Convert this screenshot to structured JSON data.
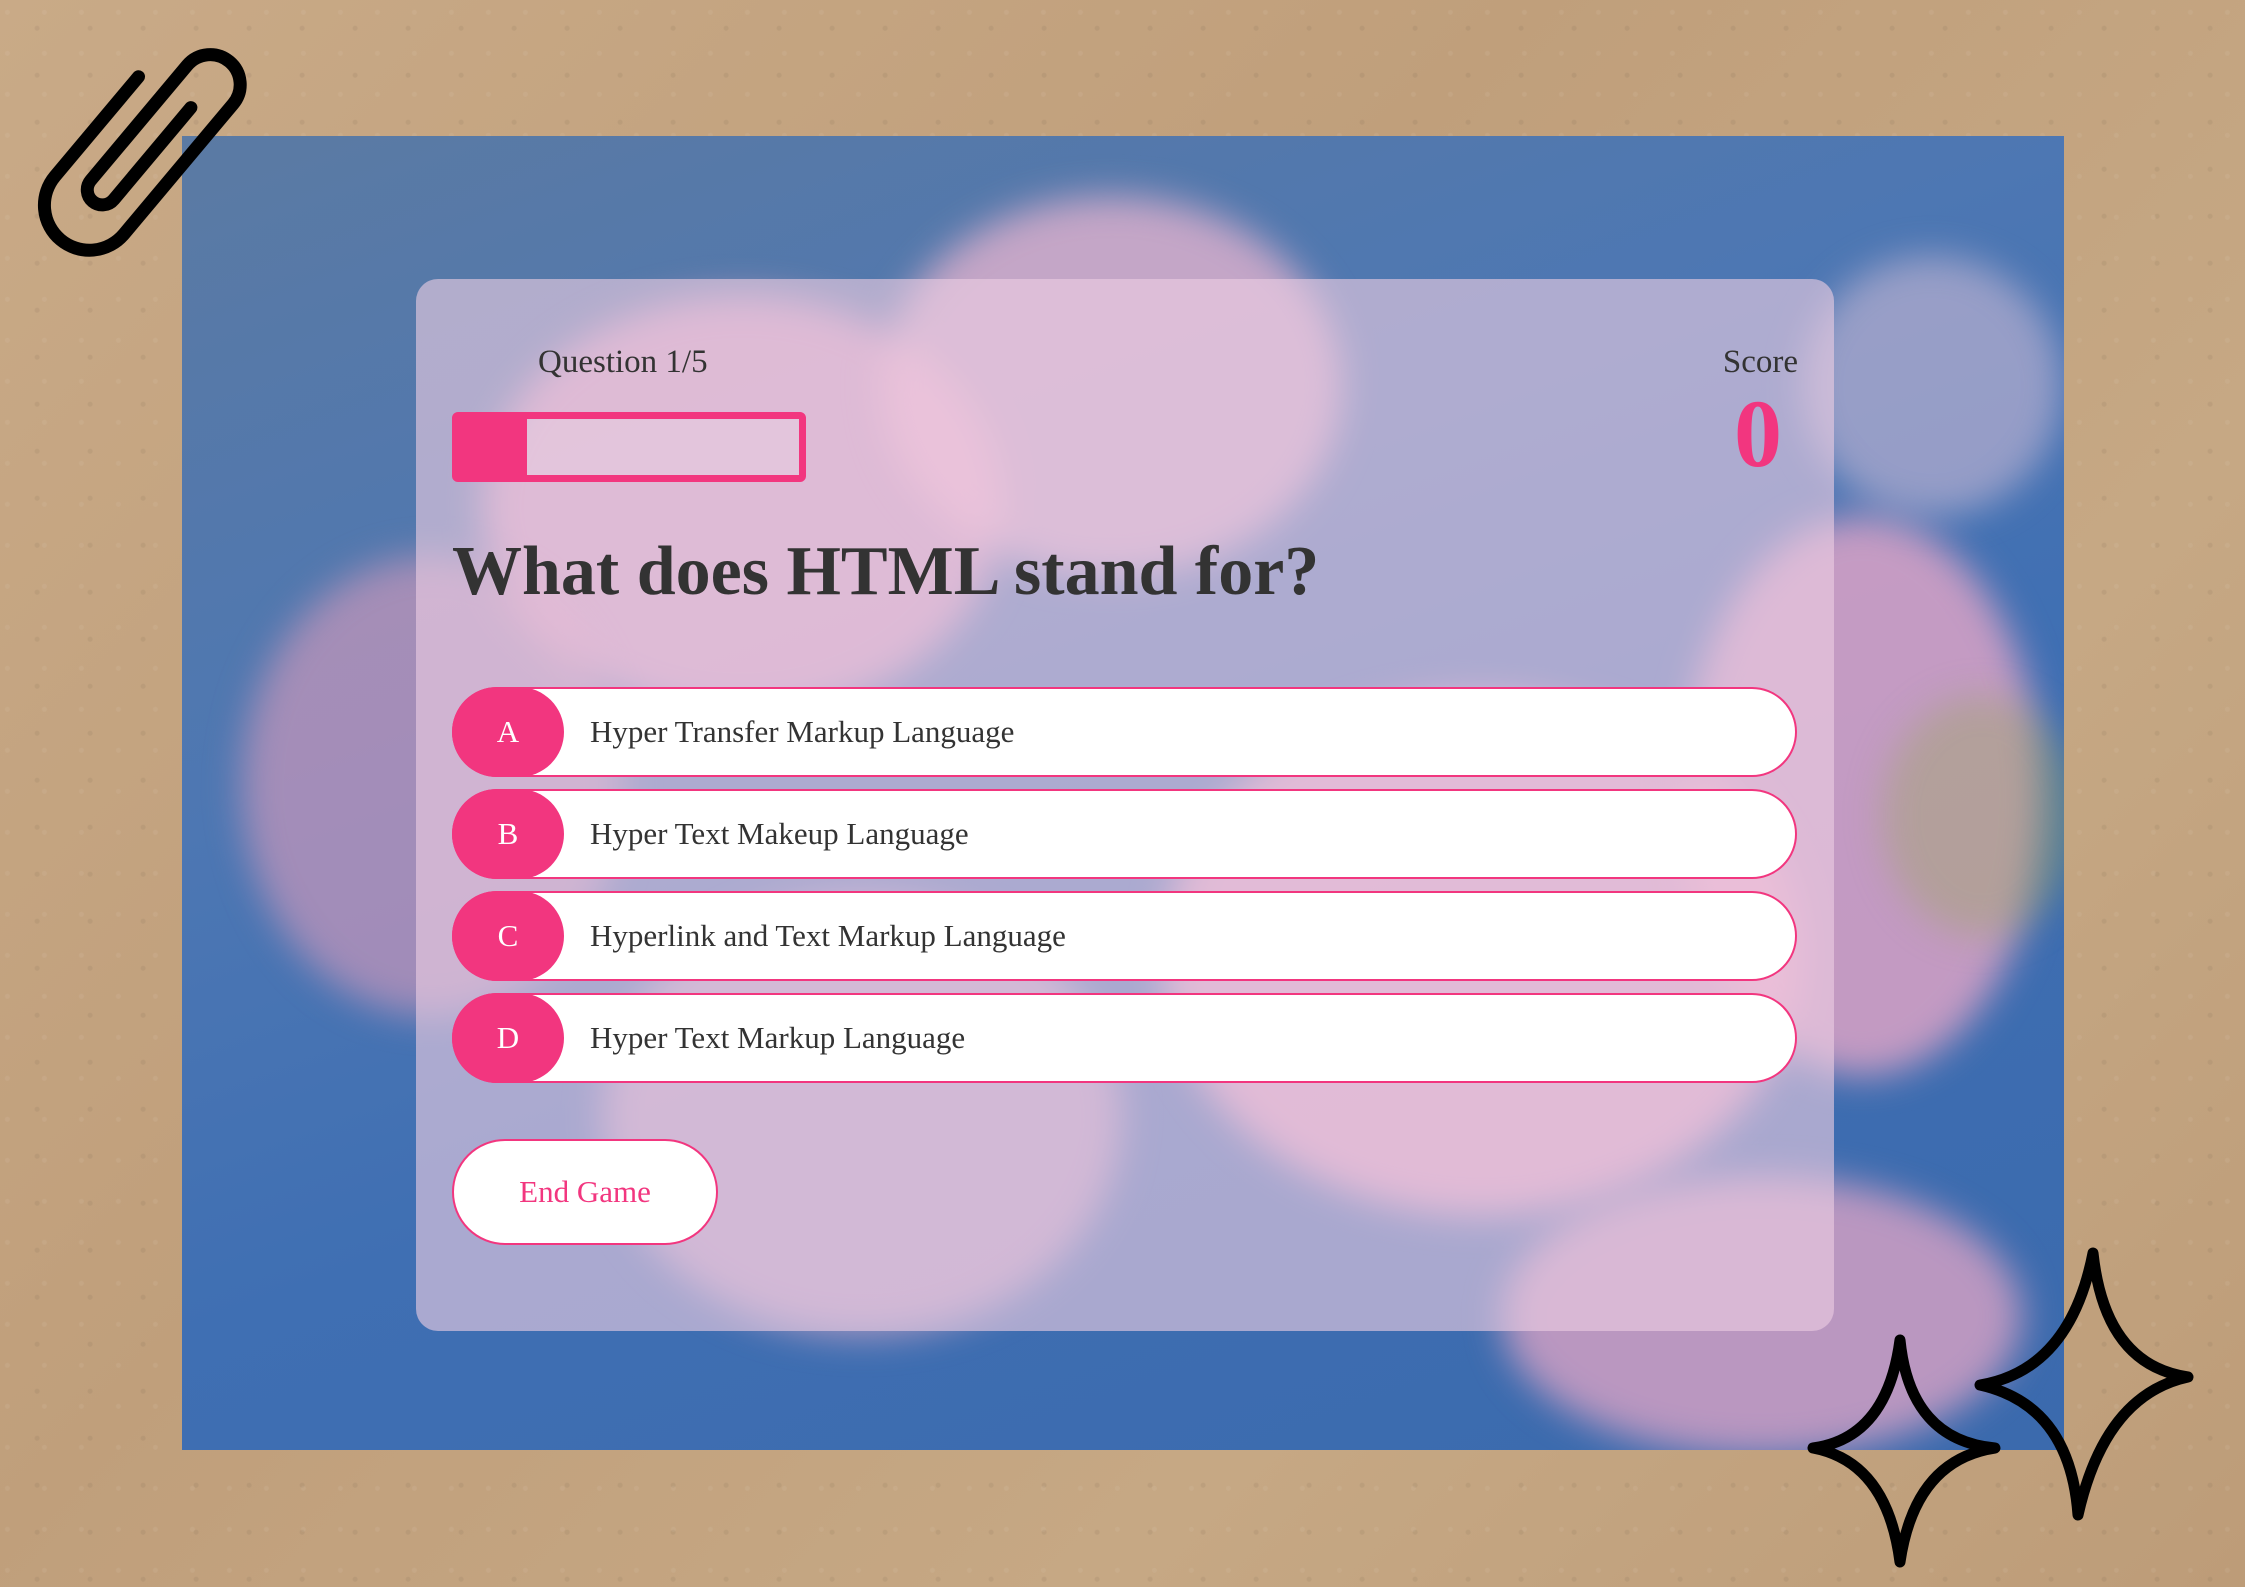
{
  "quiz": {
    "question_counter": "Question 1/5",
    "progress_fraction": 0.2,
    "score_label": "Score",
    "score_value": "0",
    "question": "What does HTML stand for?",
    "options": [
      {
        "letter": "A",
        "text": "Hyper Transfer Markup Language"
      },
      {
        "letter": "B",
        "text": "Hyper Text Makeup Language"
      },
      {
        "letter": "C",
        "text": "Hyperlink and Text Markup Language"
      },
      {
        "letter": "D",
        "text": "Hyper Text Markup Language"
      }
    ],
    "end_button": "End Game"
  },
  "colors": {
    "accent": "#f2367f",
    "text": "#333333",
    "sky": "#4d77b3",
    "paper": "#c4a582"
  },
  "icons": [
    "paperclip-icon",
    "sparkle-icon"
  ]
}
